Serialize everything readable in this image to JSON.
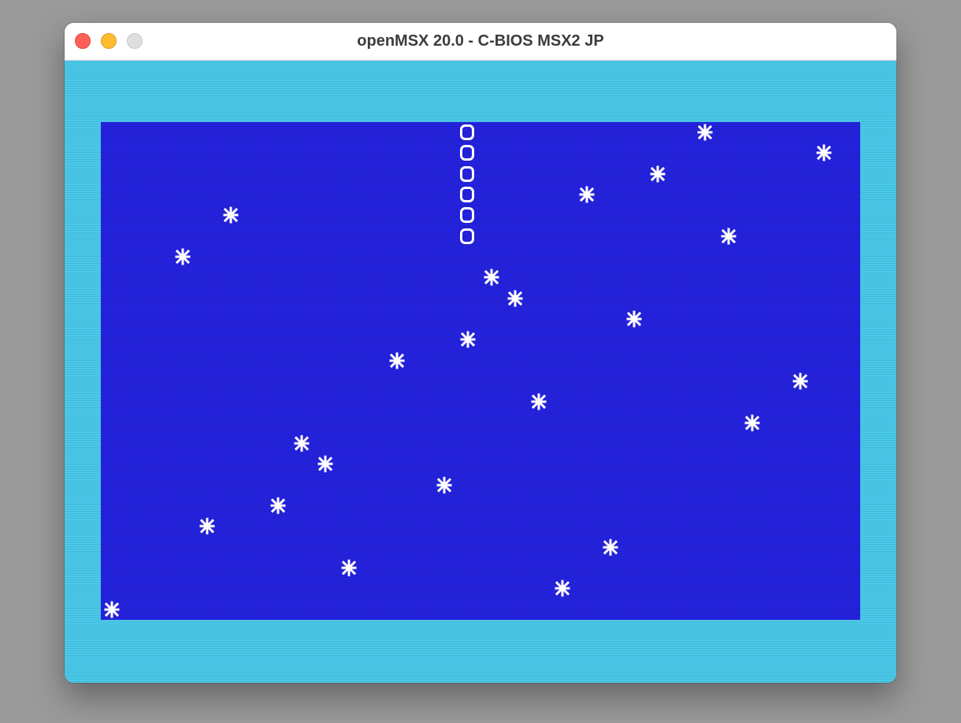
{
  "window": {
    "title": "openMSX 20.0 - C-BIOS MSX2 JP",
    "controls": [
      "close",
      "minimize",
      "zoom"
    ]
  },
  "colors": {
    "border": "#4ac8e8",
    "playfield": "#2523e0",
    "sprite": "#ffffff"
  },
  "game": {
    "snake_segment_icon": "ring-icon",
    "obstacle_icon": "asterisk-icon",
    "grid_note": "Positions in character cells (col,row) on the 32x24 MSX text grid",
    "snake": [
      {
        "col": 15,
        "row": 0
      },
      {
        "col": 15,
        "row": 1
      },
      {
        "col": 15,
        "row": 2
      },
      {
        "col": 15,
        "row": 3
      },
      {
        "col": 15,
        "row": 4
      },
      {
        "col": 15,
        "row": 5
      }
    ],
    "stars": [
      {
        "col": 25,
        "row": 0
      },
      {
        "col": 30,
        "row": 1
      },
      {
        "col": 23,
        "row": 2
      },
      {
        "col": 20,
        "row": 3
      },
      {
        "col": 5,
        "row": 4
      },
      {
        "col": 26,
        "row": 5
      },
      {
        "col": 3,
        "row": 6
      },
      {
        "col": 16,
        "row": 7
      },
      {
        "col": 17,
        "row": 8
      },
      {
        "col": 22,
        "row": 9
      },
      {
        "col": 15,
        "row": 10
      },
      {
        "col": 12,
        "row": 11
      },
      {
        "col": 29,
        "row": 12
      },
      {
        "col": 18,
        "row": 13
      },
      {
        "col": 27,
        "row": 14
      },
      {
        "col": 8,
        "row": 15
      },
      {
        "col": 9,
        "row": 16
      },
      {
        "col": 14,
        "row": 17
      },
      {
        "col": 7,
        "row": 18
      },
      {
        "col": 4,
        "row": 19
      },
      {
        "col": 21,
        "row": 20
      },
      {
        "col": 10,
        "row": 21
      },
      {
        "col": 19,
        "row": 22
      },
      {
        "col": 0,
        "row": 23
      }
    ]
  }
}
